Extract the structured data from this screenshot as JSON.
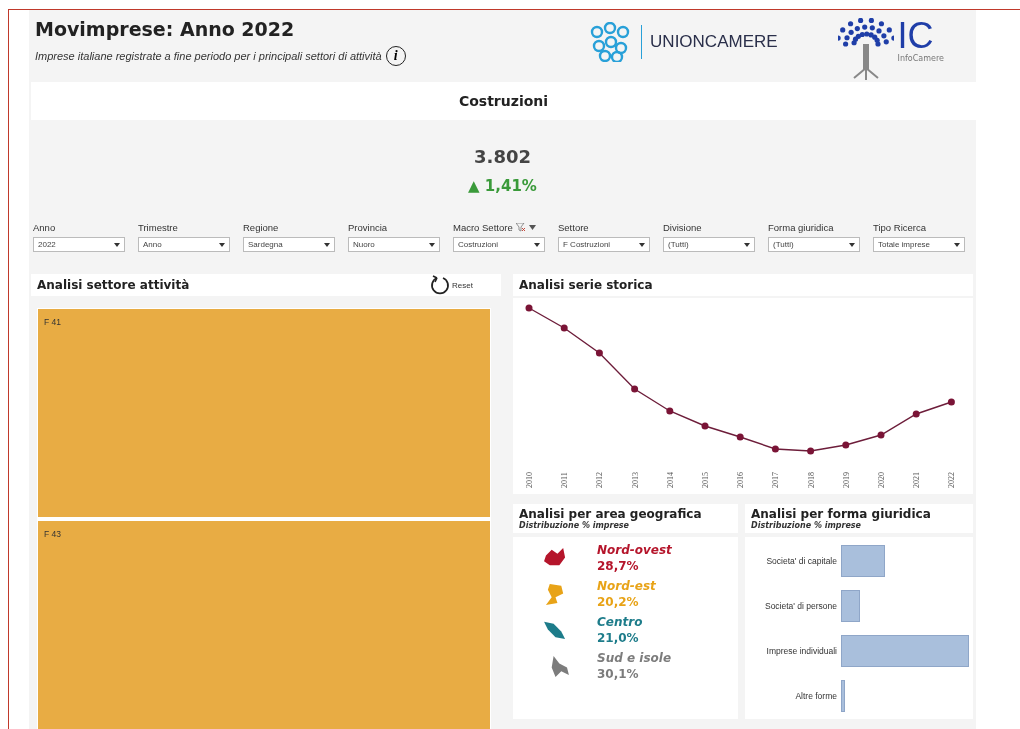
{
  "header": {
    "title": "Movimprese: Anno 2022",
    "subtitle": "Imprese italiane registrate a fine periodo per i principali settori di attività",
    "info_icon": "i",
    "logo_text": "UNIONCAMERE",
    "logo2_text": "IC",
    "logo2_caption": "InfoCamere"
  },
  "sector": {
    "title": "Costruzioni",
    "value": "3.802",
    "change": "▲ 1,41%"
  },
  "filters": [
    {
      "label": "Anno",
      "value": "2022",
      "kind": "plain"
    },
    {
      "label": "Trimestre",
      "value": "Anno",
      "kind": "plain"
    },
    {
      "label": "Regione",
      "value": "Sardegna",
      "kind": "plain"
    },
    {
      "label": "Provincia",
      "value": "Nuoro",
      "kind": "plain"
    },
    {
      "label": "Macro Settore",
      "value": "Costruzioni",
      "kind": "filtered"
    },
    {
      "label": "Settore",
      "value": "F Costruzioni",
      "kind": "plain"
    },
    {
      "label": "Divisione",
      "value": "(Tutti)",
      "kind": "plain"
    },
    {
      "label": "Forma giuridica",
      "value": "(Tutti)",
      "kind": "plain"
    },
    {
      "label": "Tipo Ricerca",
      "value": "Totale imprese",
      "kind": "plain"
    }
  ],
  "sector_panel": {
    "title": "Analisi settore attività",
    "reset": "Reset",
    "tiles": [
      {
        "label": "F 41"
      },
      {
        "label": "F 43"
      }
    ]
  },
  "history_panel": {
    "title": "Analisi serie storica",
    "years": [
      "2010",
      "2011",
      "2012",
      "2013",
      "2014",
      "2015",
      "2016",
      "2017",
      "2018",
      "2019",
      "2020",
      "2021",
      "2022"
    ]
  },
  "area_panel": {
    "title": "Analisi per area geografica",
    "subtitle": "Distribuzione % imprese",
    "areas": [
      {
        "name": "Nord-ovest",
        "share": "28,7%",
        "color": "#b5152b"
      },
      {
        "name": "Nord-est",
        "share": "20,2%",
        "color": "#e8a317"
      },
      {
        "name": "Centro",
        "share": "21,0%",
        "color": "#1d7c8a"
      },
      {
        "name": "Sud e isole",
        "share": "30,1%",
        "color": "#7c7c7c"
      }
    ]
  },
  "form_panel": {
    "title": "Analisi per forma giuridica",
    "subtitle": "Distribuzione % imprese",
    "bars": [
      {
        "label": "Societa' di capitale"
      },
      {
        "label": "Societa' di persone"
      },
      {
        "label": "Imprese individuali"
      },
      {
        "label": "Altre forme"
      }
    ]
  }
}
